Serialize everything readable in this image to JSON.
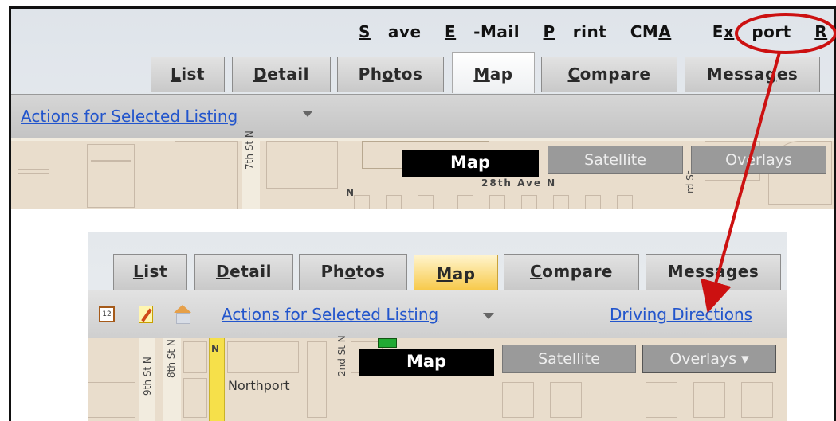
{
  "top": {
    "menu": [
      "Save",
      "E-Mail",
      "Print",
      "CMA",
      "Export",
      "Route"
    ],
    "tabs": [
      "List",
      "Detail",
      "Photos",
      "Map",
      "Compare",
      "Messages"
    ],
    "active_tab": "Map",
    "actions_label": "Actions for Selected Listing",
    "map_buttons": [
      "Map",
      "Satellite",
      "Overlays"
    ],
    "streets": [
      "7th St N",
      "28th Ave N",
      "N",
      "rd St"
    ]
  },
  "bottom": {
    "tabs": [
      "List",
      "Detail",
      "Photos",
      "Map",
      "Compare",
      "Messages"
    ],
    "active_tab": "Map",
    "actions_label": "Actions for Selected Listing",
    "driving_directions": "Driving Directions",
    "map_buttons": [
      "Map",
      "Satellite",
      "Overlays ▾"
    ],
    "streets": [
      "8th St N",
      "9th St N",
      "N",
      "2nd St N",
      "Northport"
    ]
  },
  "colors": {
    "highlight_red": "#cc1111",
    "active_tab_top": "#ffffff",
    "active_tab_bottom": "#f7c948",
    "link_blue": "#2255cc"
  }
}
